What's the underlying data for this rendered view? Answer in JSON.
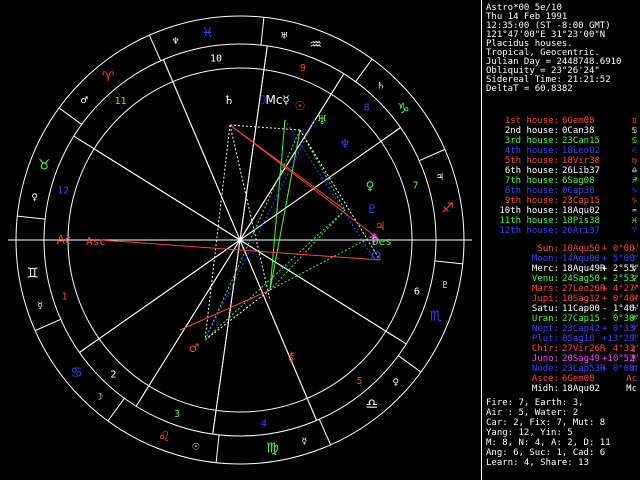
{
  "header": {
    "name": "Astro*00 5e/10",
    "date": "Thu 14 Feb 1991",
    "time": "12:35:00 (ST -8:00 GMT)",
    "location": "121°47'00\"E 31°23'00\"N",
    "house_system": "Placidus houses.",
    "zodiac": "Tropical, Geocentric.",
    "julian_day": "Julian Day = 2448748.6910",
    "obliquity": "Obliquity = 23°26'24\"",
    "sidereal": "Sidereal Time: 21:21:52",
    "delta_t": "DeltaT = 60.8382"
  },
  "houses": [
    {
      "label": "1st house:",
      "value": "6Gem08",
      "color": "#ff4040",
      "glyph": "♊"
    },
    {
      "label": "2nd house:",
      "value": "0Can38",
      "color": "#ffffff",
      "glyph": "♋"
    },
    {
      "label": "3rd house:",
      "value": "23Can15",
      "color": "#40ff40",
      "glyph": "♋"
    },
    {
      "label": "4th house:",
      "value": "18Leo02",
      "color": "#4040ff",
      "glyph": "♌"
    },
    {
      "label": "5th house:",
      "value": "18Vir38",
      "color": "#ff4040",
      "glyph": "♍"
    },
    {
      "label": "6th house:",
      "value": "26Lib37",
      "color": "#ffffff",
      "glyph": "♎"
    },
    {
      "label": "7th house:",
      "value": "6Sag08",
      "color": "#40ff40",
      "glyph": "♐"
    },
    {
      "label": "8th house:",
      "value": "0Cap38",
      "color": "#4040ff",
      "glyph": "♑"
    },
    {
      "label": "9th house:",
      "value": "23Cap15",
      "color": "#ff4040",
      "glyph": "♑"
    },
    {
      "label": "10th house:",
      "value": "18Aqu02",
      "color": "#ffffff",
      "glyph": "♒"
    },
    {
      "label": "11th house:",
      "value": "18Pis38",
      "color": "#40ff40",
      "glyph": "♓"
    },
    {
      "label": "12th house:",
      "value": "26Ari37",
      "color": "#4040ff",
      "glyph": "♈"
    }
  ],
  "planets": [
    {
      "label": "Sun:",
      "value": "10Aqu50",
      "aspect": "+ 0°00'",
      "color": "#ff4040",
      "glyph": "☉"
    },
    {
      "label": "Moon:",
      "value": "14Aqu00",
      "aspect": "+ 5°00'",
      "color": "#4040ff",
      "glyph": "☽"
    },
    {
      "label": "Merc:",
      "value": "18Aqu49R",
      "aspect": "+ 2°55'",
      "color": "#ffffff",
      "glyph": "☿"
    },
    {
      "label": "Venu:",
      "value": "24Sag50",
      "aspect": "+ 2°53'",
      "color": "#40ff40",
      "glyph": "♀"
    },
    {
      "label": "Mars:",
      "value": "27Leo26R",
      "aspect": "+ 4°27'",
      "color": "#ff4040",
      "glyph": "♂"
    },
    {
      "label": "Jupi:",
      "value": "10Sag12",
      "aspect": "+ 0°46'",
      "color": "#ff4040",
      "glyph": "♃"
    },
    {
      "label": "Satu:",
      "value": "11Cap00",
      "aspect": "- 1°46'",
      "color": "#ffffff",
      "glyph": "♄"
    },
    {
      "label": "Uran:",
      "value": "27Cap15",
      "aspect": "- 0°30'",
      "color": "#40ff40",
      "glyph": "♅"
    },
    {
      "label": "Nept:",
      "value": "23Cap42",
      "aspect": "+ 0°33'",
      "color": "#4040ff",
      "glyph": "♆"
    },
    {
      "label": "Plut:",
      "value": "0Sag18",
      "aspect": "+13°29'",
      "color": "#4040ff",
      "glyph": "♇"
    },
    {
      "label": "Chir:",
      "value": "27Vir26R",
      "aspect": "- 4°31'",
      "color": "#ff4040",
      "glyph": "⚷"
    },
    {
      "label": "Juno:",
      "value": "20Sag49",
      "aspect": "+10°52'",
      "color": "#ff40ff",
      "glyph": "⚵"
    },
    {
      "label": "Node:",
      "value": "23Cap53R",
      "aspect": "+ 0°00'",
      "color": "#4040ff",
      "glyph": "☊"
    },
    {
      "label": "Asce:",
      "value": "6Gem08",
      "aspect": "",
      "color": "#ff4040",
      "glyph": "Ac"
    },
    {
      "label": "Midh:",
      "value": "18Aqu02",
      "aspect": "",
      "color": "#ffffff",
      "glyph": "Mc"
    }
  ],
  "summary": {
    "line1": "Fire: 7, Earth: 3,",
    "line2": "Air : 5, Water: 2",
    "line3": "Car: 2, Fix: 7, Mut: 8",
    "line4": "Yang: 12, Yin: 5",
    "line5": "M: 8, N: 4, A: 2, D: 11",
    "line6": "Ang: 6, Suc: 1, Cad: 6",
    "line7": "Learn: 4, Share: 13"
  },
  "wheel": {
    "asc_label": "Asc",
    "des_label": "Des",
    "house_numbers": [
      "1",
      "2",
      "3",
      "4",
      "5",
      "6",
      "7",
      "8",
      "9",
      "10",
      "11",
      "12"
    ],
    "signs": [
      {
        "name": "aries-icon",
        "glyph": "♈",
        "color": "#ff4040"
      },
      {
        "name": "taurus-icon",
        "glyph": "♉",
        "color": "#40ff40"
      },
      {
        "name": "gemini-icon",
        "glyph": "♊",
        "color": "#ffffff"
      },
      {
        "name": "cancer-icon",
        "glyph": "♋",
        "color": "#4040ff"
      },
      {
        "name": "leo-icon",
        "glyph": "♌",
        "color": "#ff4040"
      },
      {
        "name": "virgo-icon",
        "glyph": "♍",
        "color": "#40ff40"
      },
      {
        "name": "libra-icon",
        "glyph": "♎",
        "color": "#ffffff"
      },
      {
        "name": "scorpio-icon",
        "glyph": "♏",
        "color": "#4040ff"
      },
      {
        "name": "sagittarius-icon",
        "glyph": "♐",
        "color": "#ff4040"
      },
      {
        "name": "capricorn-icon",
        "glyph": "♑",
        "color": "#40ff40"
      },
      {
        "name": "aquarius-icon",
        "glyph": "♒",
        "color": "#ffffff"
      },
      {
        "name": "pisces-icon",
        "glyph": "♓",
        "color": "#4040ff"
      }
    ],
    "ruler_glyphs": [
      "♂",
      "♀",
      "☿",
      "☽",
      "☉",
      "☿",
      "♀",
      "♇",
      "♃",
      "♄",
      "♅",
      "♆"
    ],
    "colors": {
      "red": "#ff4040",
      "green": "#40ff40",
      "blue": "#4040ff",
      "white": "#ffffff",
      "magenta": "#ff40ff"
    }
  }
}
